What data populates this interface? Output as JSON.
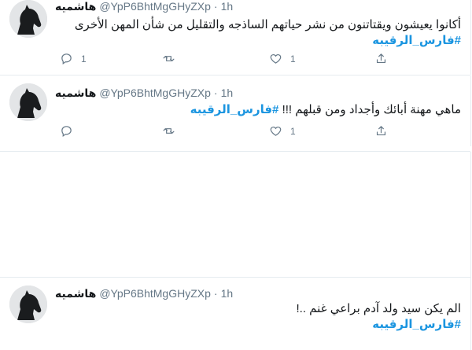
{
  "tweets": [
    {
      "name": "هاشميه",
      "handle": "@YpP6BhtMgGHyZXp",
      "separator": "·",
      "time": "1h",
      "line1": "أكانوا يعيشون ويقتاتنون من نشر حياتهم الساذجه والتقليل من شأن المهن الأخرى",
      "hashtag": "#فارس_الرقيبه",
      "reply_count": "1",
      "like_count": "1"
    },
    {
      "name": "هاشميه",
      "handle": "@YpP6BhtMgGHyZXp",
      "separator": "·",
      "time": "1h",
      "text": "ماهي مهنة أبائك وأجداد ومن قبلهم !!!",
      "hashtag": "#فارس_الرقيبه",
      "reply_count": "",
      "like_count": "1"
    },
    {
      "name": "هاشميه",
      "handle": "@YpP6BhtMgGHyZXp",
      "separator": "·",
      "time": "1h",
      "text": "الم يكن سيد ولد آدم براعي غنم ..!",
      "hashtag": "#فارس_الرقيبه"
    }
  ],
  "colors": {
    "accent": "#1b95e0",
    "muted": "#657786",
    "border": "#e6ecf0"
  },
  "icons": [
    "reply-icon",
    "retweet-icon",
    "like-icon",
    "share-icon"
  ]
}
